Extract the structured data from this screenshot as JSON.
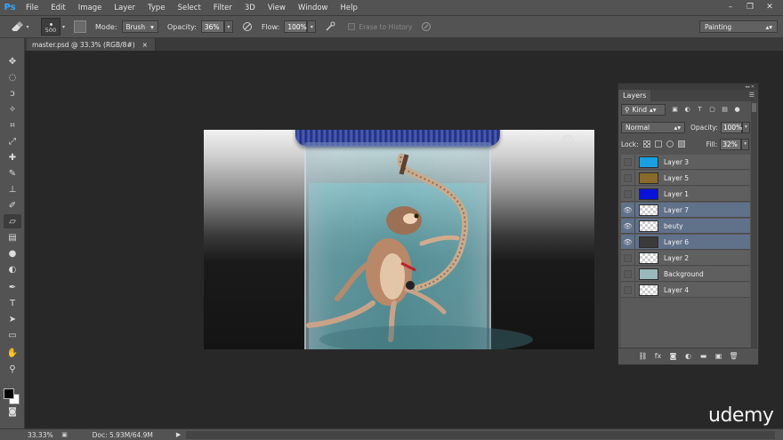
{
  "app": {
    "logo": "Ps"
  },
  "menu": [
    "File",
    "Edit",
    "Image",
    "Layer",
    "Type",
    "Select",
    "Filter",
    "3D",
    "View",
    "Window",
    "Help"
  ],
  "window_controls": [
    "–",
    "❐",
    "✕"
  ],
  "options": {
    "brush_size": "500",
    "mode_label": "Mode:",
    "mode_value": "Brush",
    "opacity_label": "Opacity:",
    "opacity_value": "36%",
    "flow_label": "Flow:",
    "flow_value": "100%",
    "erase_history_label": "Erase to History",
    "workspace": "Painting"
  },
  "document": {
    "tab_title": "master.psd @ 33.3% (RGB/8#)",
    "close": "×"
  },
  "layers_panel": {
    "tab": "Layers",
    "filter_kind": "Kind",
    "blend_mode": "Normal",
    "opacity_label": "Opacity:",
    "opacity_value": "100%",
    "lock_label": "Lock:",
    "fill_label": "Fill:",
    "fill_value": "32%",
    "layers": [
      {
        "name": "Layer 3",
        "visible": false,
        "selected": false,
        "thumb": "#1a9fe0"
      },
      {
        "name": "Layer 5",
        "visible": false,
        "selected": false,
        "thumb": "#8a6a2a"
      },
      {
        "name": "Layer 1",
        "visible": false,
        "selected": false,
        "thumb": "#0a12d8"
      },
      {
        "name": "Layer 7",
        "visible": true,
        "selected": true,
        "thumb": "checker"
      },
      {
        "name": "beuty",
        "visible": true,
        "selected": true,
        "thumb": "checker"
      },
      {
        "name": "Layer 6",
        "visible": true,
        "selected": true,
        "thumb": "#3a3a3a"
      },
      {
        "name": "Layer 2",
        "visible": false,
        "selected": false,
        "thumb": "checker"
      },
      {
        "name": "Background",
        "visible": false,
        "selected": false,
        "thumb": "#9ab8bc"
      },
      {
        "name": "Layer 4",
        "visible": false,
        "selected": false,
        "thumb": "checker"
      }
    ]
  },
  "status": {
    "zoom": "33.33%",
    "doc_size": "Doc: 5.93M/64.9M",
    "arrow": "▶"
  },
  "watermark": "udemy"
}
